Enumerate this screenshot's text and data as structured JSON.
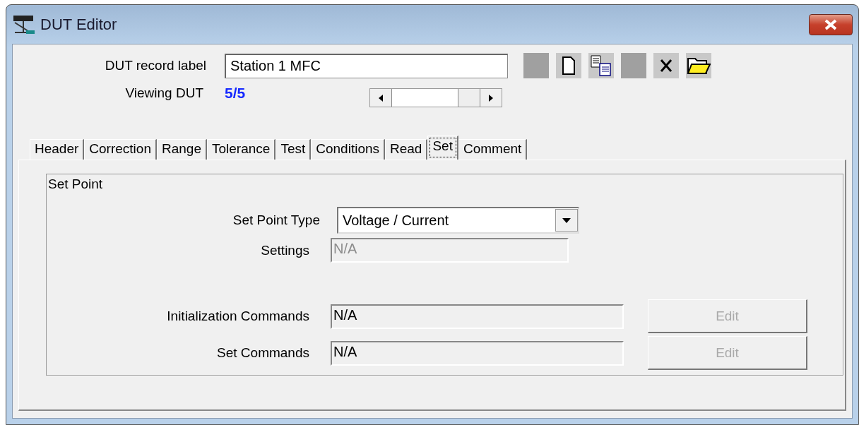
{
  "window": {
    "title": "DUT Editor"
  },
  "record": {
    "label": "DUT record label",
    "value": "Station 1 MFC",
    "viewing_label": "Viewing DUT",
    "viewing_value": "5/5"
  },
  "toolbar": [
    {
      "kind": "blank"
    },
    {
      "kind": "new"
    },
    {
      "kind": "copy"
    },
    {
      "kind": "blank"
    },
    {
      "kind": "delete"
    },
    {
      "kind": "open"
    }
  ],
  "tabs": [
    {
      "label": "Header",
      "selected": false
    },
    {
      "label": "Correction",
      "selected": false
    },
    {
      "label": "Range",
      "selected": false
    },
    {
      "label": "Tolerance",
      "selected": false
    },
    {
      "label": "Test",
      "selected": false
    },
    {
      "label": "Conditions",
      "selected": false
    },
    {
      "label": "Read",
      "selected": false
    },
    {
      "label": "Set",
      "selected": true
    },
    {
      "label": "Comment",
      "selected": false
    }
  ],
  "group": {
    "title": "Set Point",
    "set_point_type": {
      "label": "Set Point Type",
      "value": "Voltage / Current"
    },
    "settings": {
      "label": "Settings",
      "value": "N/A",
      "disabled": true
    },
    "commands": [
      {
        "label": "Initialization Commands",
        "value": "N/A",
        "button": "Edit",
        "disabled": true
      },
      {
        "label": "Set Commands",
        "value": "N/A",
        "button": "Edit",
        "disabled": true
      }
    ]
  }
}
